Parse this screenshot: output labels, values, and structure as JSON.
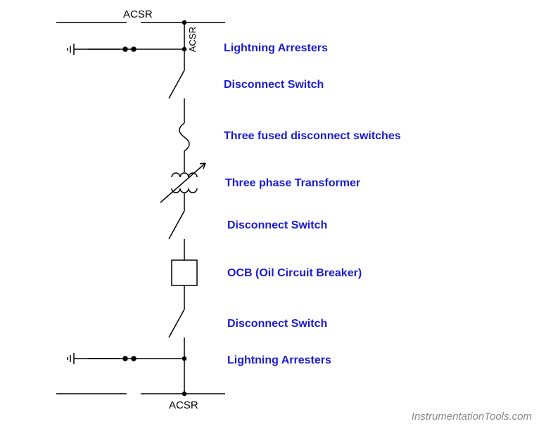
{
  "labels": {
    "acsr_top": "ACSR",
    "acsr_vert": "ACSR",
    "acsr_bottom": "ACSR",
    "lightning_arresters_top": "Lightning Arresters",
    "disconnect_switch_1": "Disconnect Switch",
    "three_fused": "Three fused disconnect switches",
    "three_phase_transformer": "Three phase Transformer",
    "disconnect_switch_2": "Disconnect Switch",
    "ocb": "OCB (Oil Circuit Breaker)",
    "disconnect_switch_3": "Disconnect Switch",
    "lightning_arresters_bottom": "Lightning Arresters",
    "watermark": "InstrumentationTools.com"
  },
  "chart_data": {
    "type": "table",
    "title": "Electrical Single Line Diagram",
    "components_top_to_bottom": [
      {
        "name": "ACSR line (top bus)",
        "symbol": "horizontal-line"
      },
      {
        "name": "Lightning Arresters",
        "symbol": "arrester-to-ground"
      },
      {
        "name": "Disconnect Switch",
        "symbol": "open-switch"
      },
      {
        "name": "Three fused disconnect switches",
        "symbol": "fuse"
      },
      {
        "name": "Three phase Transformer",
        "symbol": "transformer-with-arrow"
      },
      {
        "name": "Disconnect Switch",
        "symbol": "open-switch"
      },
      {
        "name": "OCB (Oil Circuit Breaker)",
        "symbol": "square-box"
      },
      {
        "name": "Disconnect Switch",
        "symbol": "open-switch"
      },
      {
        "name": "Lightning Arresters",
        "symbol": "arrester-to-ground"
      },
      {
        "name": "ACSR line (bottom bus)",
        "symbol": "horizontal-line"
      }
    ]
  }
}
